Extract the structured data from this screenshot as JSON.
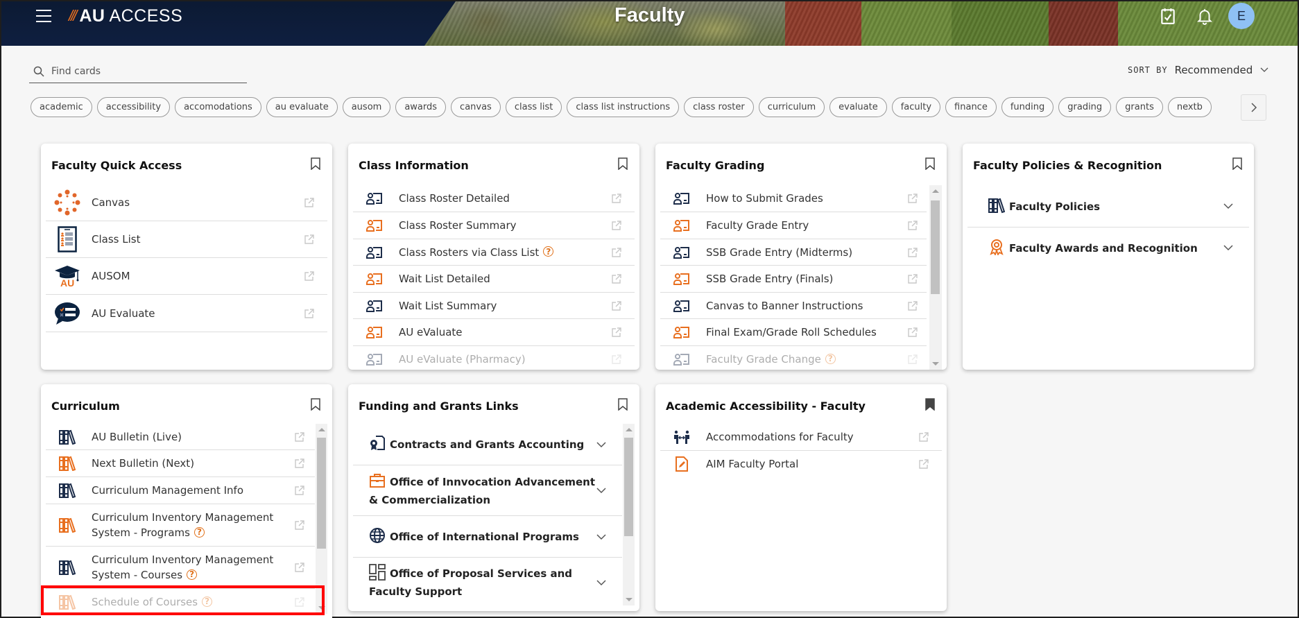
{
  "header": {
    "logo_slashes": "///",
    "logo_au": "AU",
    "logo_access": "ACCESS",
    "page_title": "Faculty",
    "avatar_initial": "E",
    "icons": [
      "menu-icon",
      "calendar-check-icon",
      "bell-icon"
    ]
  },
  "search": {
    "placeholder": "Find cards",
    "value": ""
  },
  "sort": {
    "label": "SORT BY",
    "value": "Recommended"
  },
  "tags": [
    "academic",
    "accessibility",
    "accomodations",
    "au evaluate",
    "ausom",
    "awards",
    "canvas",
    "class list",
    "class list instructions",
    "class roster",
    "curriculum",
    "evaluate",
    "faculty",
    "finance",
    "funding",
    "grading",
    "grants",
    "nextb"
  ],
  "colors": {
    "navy": "#0c2340",
    "orange": "#e86f1f",
    "page_bg": "#f6f6f6",
    "highlight": "#ff0000"
  },
  "cards": {
    "quick_access": {
      "title": "Faculty Quick Access",
      "bookmarked": false,
      "items": [
        {
          "label": "Canvas",
          "icon": "canvas-logo-icon"
        },
        {
          "label": "Class List",
          "icon": "class-list-icon"
        },
        {
          "label": "AUSOM",
          "icon": "ausom-mortarboard-icon"
        },
        {
          "label": "AU Evaluate",
          "icon": "evaluate-speech-bubble-icon"
        }
      ]
    },
    "class_info": {
      "title": "Class Information",
      "bookmarked": false,
      "items": [
        {
          "label": "Class Roster Detailed",
          "color": "navy",
          "help": false
        },
        {
          "label": "Class Roster Summary",
          "color": "orange",
          "help": false
        },
        {
          "label": "Class Rosters via Class List",
          "color": "navy",
          "help": true
        },
        {
          "label": "Wait List Detailed",
          "color": "orange",
          "help": false
        },
        {
          "label": "Wait List Summary",
          "color": "navy",
          "help": false
        },
        {
          "label": "AU eValuate",
          "color": "orange",
          "help": false
        },
        {
          "label": "AU eValuate (Pharmacy)",
          "color": "navy",
          "help": false,
          "faded": true
        }
      ]
    },
    "grading": {
      "title": "Faculty Grading",
      "bookmarked": false,
      "items": [
        {
          "label": "How to Submit Grades",
          "color": "navy",
          "help": false
        },
        {
          "label": "Faculty Grade Entry",
          "color": "orange",
          "help": false
        },
        {
          "label": "SSB Grade Entry (Midterms)",
          "color": "navy",
          "help": false
        },
        {
          "label": "SSB Grade Entry (Finals)",
          "color": "orange",
          "help": false
        },
        {
          "label": "Canvas to Banner Instructions",
          "color": "navy",
          "help": false
        },
        {
          "label": "Final Exam/Grade Roll Schedules",
          "color": "orange",
          "help": false
        },
        {
          "label": "Faculty Grade Change",
          "color": "navy",
          "help": true,
          "faded": true
        }
      ]
    },
    "policies": {
      "title": "Faculty Policies & Recognition",
      "bookmarked": false,
      "sections": [
        {
          "label": "Faculty Policies",
          "icon": "books-icon"
        },
        {
          "label": "Faculty Awards and Recognition",
          "icon": "award-ribbon-icon"
        }
      ]
    },
    "curriculum": {
      "title": "Curriculum",
      "bookmarked": false,
      "items": [
        {
          "label": "AU Bulletin (Live)",
          "color": "navy",
          "help": false
        },
        {
          "label": "Next Bulletin (Next)",
          "color": "orange",
          "help": false
        },
        {
          "label": "Curriculum Management Info",
          "color": "navy",
          "help": false
        },
        {
          "label": "Curriculum Inventory Management System - Programs",
          "color": "orange",
          "help": true
        },
        {
          "label": "Curriculum Inventory Management System - Courses",
          "color": "navy",
          "help": true
        },
        {
          "label": "Schedule of Courses",
          "color": "orange",
          "help": true,
          "faded": true
        }
      ]
    },
    "funding": {
      "title": "Funding and Grants Links",
      "bookmarked": false,
      "sections": [
        {
          "label": "Contracts and Grants Accounting",
          "icon": "certificate-document-icon"
        },
        {
          "label": "Office of Innvocation Advancement & Commercialization",
          "icon": "briefcase-icon"
        },
        {
          "label": "Office of International Programs",
          "icon": "globe-icon"
        },
        {
          "label": "Office of Proposal Services and Faculty Support",
          "icon": "dashboard-grid-icon"
        }
      ]
    },
    "accessibility": {
      "title": "Academic Accessibility - Faculty",
      "bookmarked": true,
      "items": [
        {
          "label": "Accommodations for Faculty",
          "icon": "people-exchange-icon"
        },
        {
          "label": "AIM Faculty Portal",
          "icon": "document-edit-icon"
        }
      ]
    }
  }
}
